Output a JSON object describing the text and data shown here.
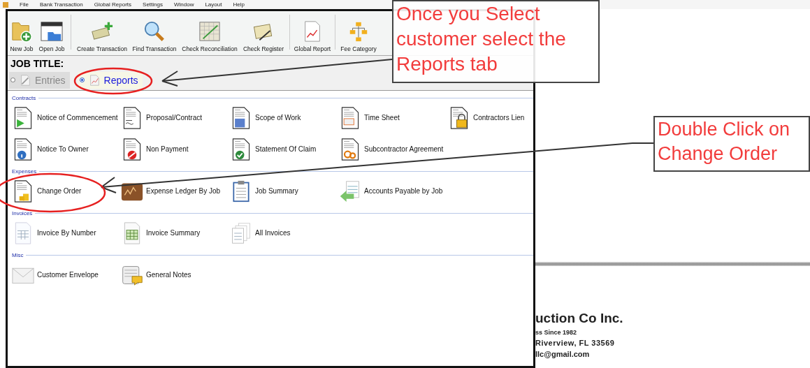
{
  "menu": [
    {
      "label": "File"
    },
    {
      "label": "Bank Transaction"
    },
    {
      "label": "Global Reports"
    },
    {
      "label": "Settings"
    },
    {
      "label": "Window"
    },
    {
      "label": "Layout"
    },
    {
      "label": "Help"
    }
  ],
  "toolbar": [
    {
      "label": "New Job"
    },
    {
      "label": "Open Job"
    },
    {
      "label": "Create Transaction"
    },
    {
      "label": "Find Transaction"
    },
    {
      "label": "Check Reconciliation"
    },
    {
      "label": "Check Register"
    },
    {
      "label": "Global Report"
    },
    {
      "label": "Fee Category"
    }
  ],
  "job_title": "JOB TITLE:",
  "tabs": [
    {
      "label": "Entries",
      "selected": false
    },
    {
      "label": "Reports",
      "selected": true
    }
  ],
  "sections": [
    {
      "title": "Contracts",
      "items": [
        "Notice of Commencement",
        "Proposal/Contract",
        "Scope of Work",
        "Time Sheet",
        "Contractors Lien",
        "Notice To Owner",
        "Non Payment",
        "Statement Of Claim",
        "Subcontractor Agreement"
      ]
    },
    {
      "title": "Expenses",
      "items": [
        "Change Order",
        "Expense Ledger By Job",
        "Job Summary",
        "Accounts Payable by Job"
      ]
    },
    {
      "title": "Invoices",
      "items": [
        "Invoice By Number",
        "Invoice Summary",
        "All Invoices"
      ]
    },
    {
      "title": "Misc",
      "items": [
        "Customer Envelope",
        "General Notes"
      ]
    }
  ],
  "background_document": {
    "lines": [
      "uction Co Inc.",
      "ss Since 1982",
      "Riverview,  FL  33569",
      "llc@gmail.com"
    ]
  },
  "callouts": [
    {
      "text": "Once you Select customer select the Reports tab"
    },
    {
      "text": "Double Click on Change Order"
    }
  ]
}
